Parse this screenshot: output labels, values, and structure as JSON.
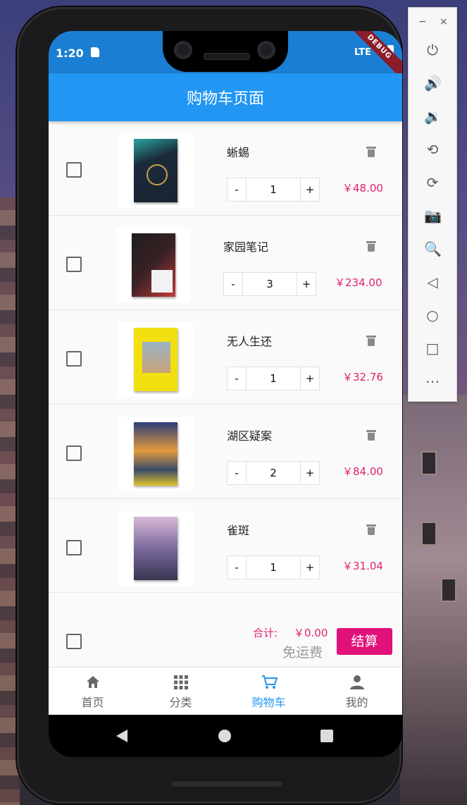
{
  "status_bar": {
    "time": "1:20",
    "network": "LTE",
    "debug_banner": "DEBUG"
  },
  "app_bar": {
    "title": "购物车页面"
  },
  "cart_items": [
    {
      "title": "蜥蜴",
      "quantity": "1",
      "price": "￥48.00",
      "minus": "-",
      "plus": "+"
    },
    {
      "title": "家园笔记",
      "quantity": "3",
      "price": "￥234.00",
      "minus": "-",
      "plus": "+"
    },
    {
      "title": "无人生还",
      "quantity": "1",
      "price": "￥32.76",
      "minus": "-",
      "plus": "+"
    },
    {
      "title": "湖区疑案",
      "quantity": "2",
      "price": "￥84.00",
      "minus": "-",
      "plus": "+"
    },
    {
      "title": "雀斑",
      "quantity": "1",
      "price": "￥31.04",
      "minus": "-",
      "plus": "+"
    }
  ],
  "summary": {
    "total_label": "合计:",
    "total_value": "￥0.00",
    "shipping_note": "免运费",
    "checkout_label": "结算"
  },
  "bottom_nav": [
    {
      "label": "首页",
      "icon": "home-icon"
    },
    {
      "label": "分类",
      "icon": "grid-icon"
    },
    {
      "label": "购物车",
      "icon": "cart-icon",
      "active": true
    },
    {
      "label": "我的",
      "icon": "person-icon"
    }
  ],
  "emulator_toolbar": {
    "minimize": "−",
    "close": "×",
    "tools": [
      "power-icon",
      "volume-up-icon",
      "volume-down-icon",
      "rotate-left-icon",
      "rotate-right-icon",
      "camera-icon",
      "zoom-icon",
      "back-icon",
      "home-icon",
      "overview-icon",
      "more-icon"
    ]
  },
  "colors": {
    "app_bar": "#2196f3",
    "status_bar": "#1a7fd3",
    "price": "#e0206f",
    "checkout": "#e0117a",
    "active_tab": "#2196f3"
  }
}
